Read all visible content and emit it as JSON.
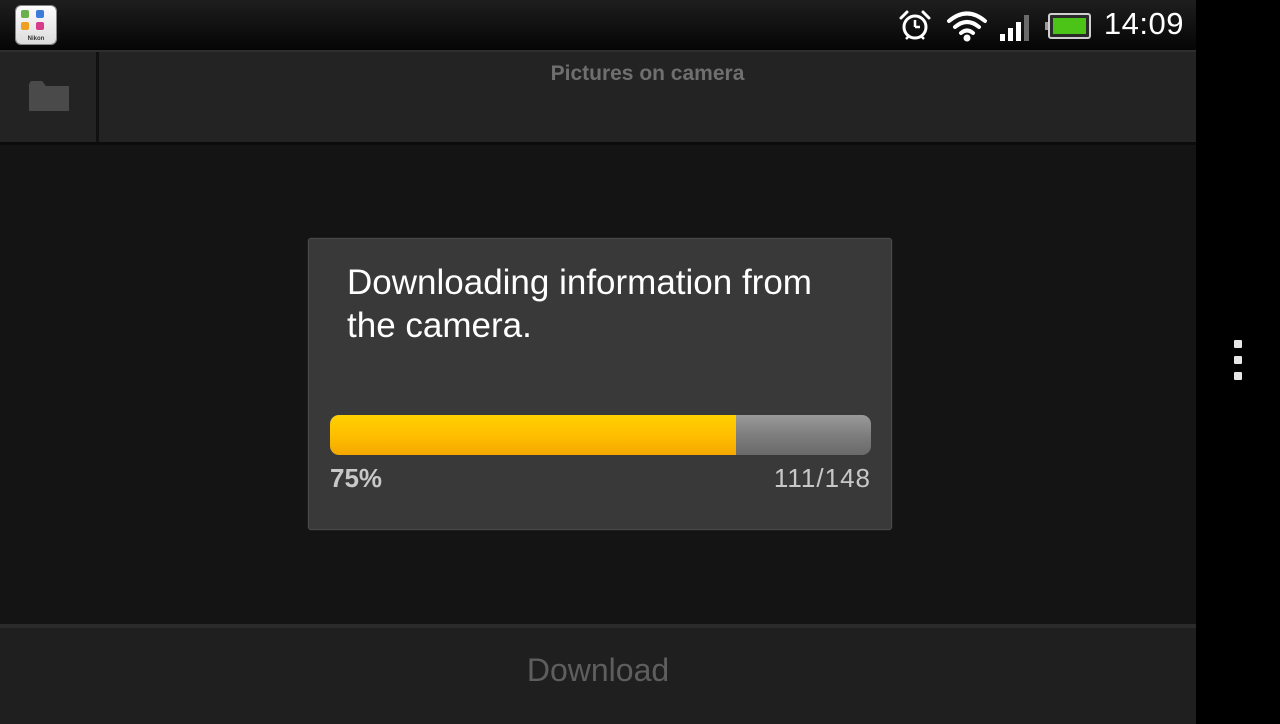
{
  "status_bar": {
    "app_icon": "nikon-app-icon",
    "app_icon_brand": "Nikon",
    "icons": [
      "alarm-clock-icon",
      "wifi-icon",
      "cell-signal-icon",
      "battery-icon"
    ],
    "time": "14:09"
  },
  "top_bar": {
    "folder_icon": "folder-icon",
    "title": "Pictures on camera"
  },
  "dialog": {
    "message": "Downloading information from the camera.",
    "progress": {
      "percent_label": "75%",
      "count_label": "111/148",
      "fraction": 0.75
    }
  },
  "bottom_bar": {
    "download_label": "Download"
  },
  "overflow_menu_icon": "overflow-menu-icon",
  "colors": {
    "progress_fill": "#ffbf00",
    "progress_track": "#7e7e7e",
    "battery_green": "#4cc417"
  }
}
